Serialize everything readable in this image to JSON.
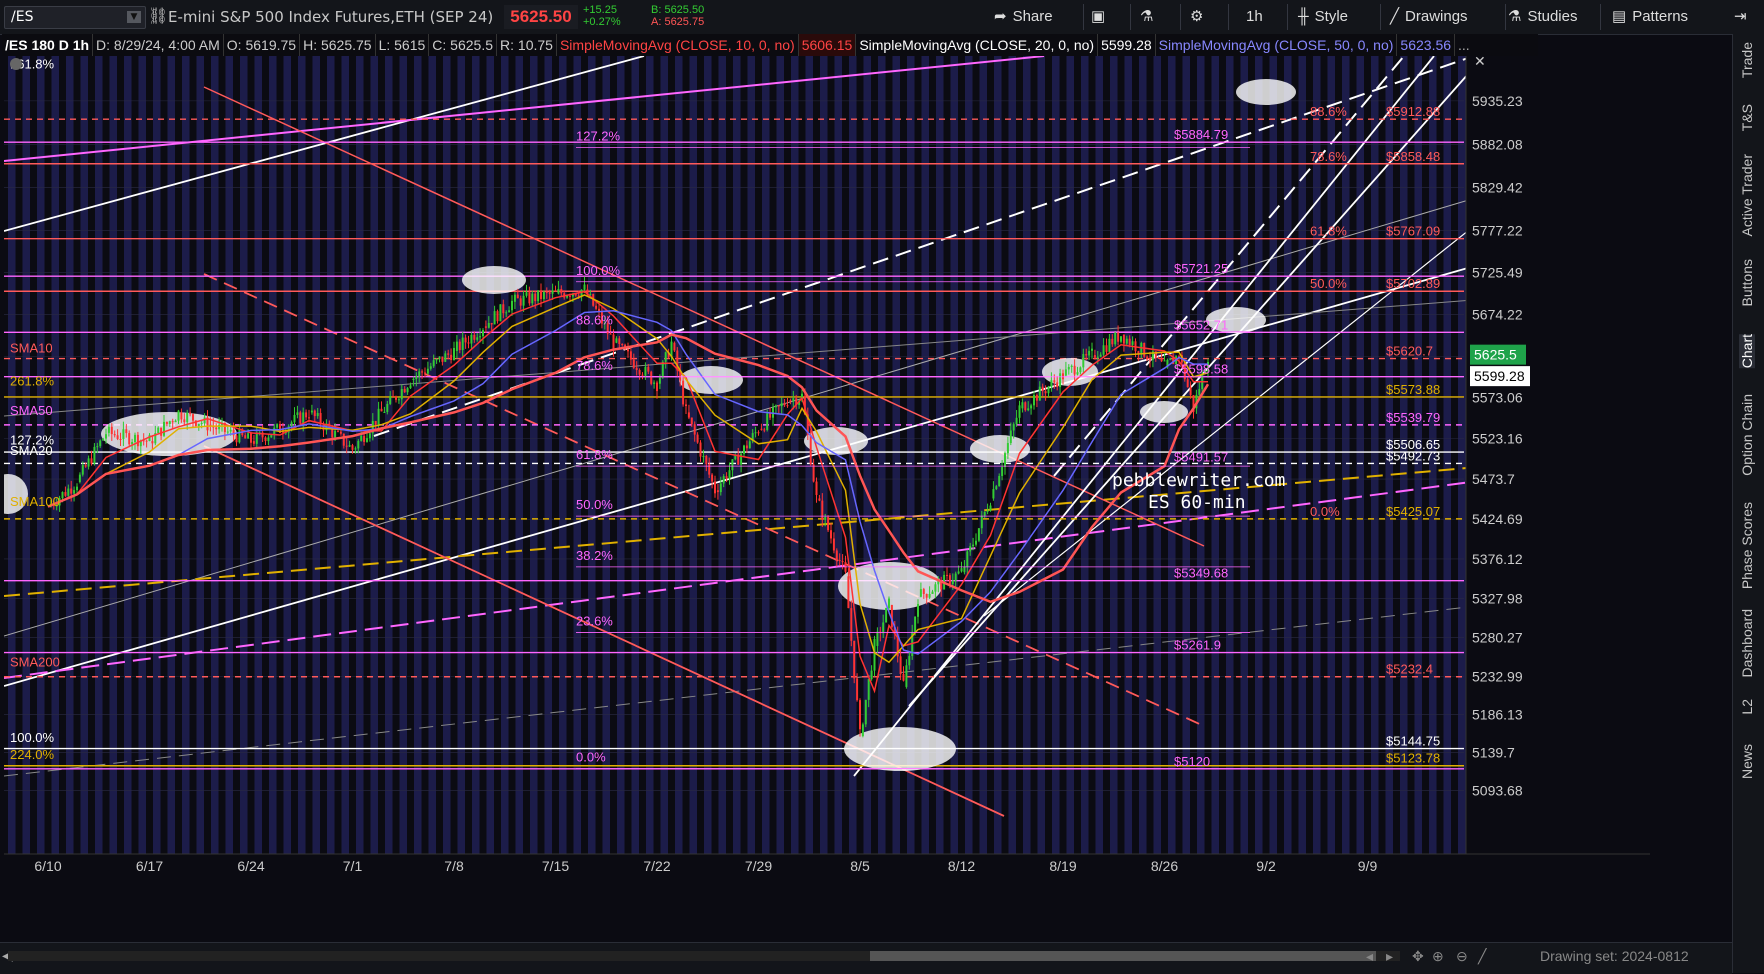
{
  "toolbar": {
    "symbol": "/ES",
    "description": "E-mini S&P 500 Index Futures,ETH (SEP 24)",
    "last_price": "5625.50",
    "net_change": "+15.25",
    "pct_change": "+0.27%",
    "bid": "B: 5625.50",
    "ask": "A: 5625.75",
    "share_label": "Share",
    "timeframe_label": "1h",
    "style_label": "Style",
    "drawings_label": "Drawings",
    "studies_label": "Studies",
    "patterns_label": "Patterns"
  },
  "infobar": {
    "chart_id": "/ES 180 D 1h",
    "date": "D: 8/29/24, 4:00 AM",
    "open": "O: 5619.75",
    "high": "H: 5625.75",
    "low": "L: 5615",
    "close": "C: 5625.5",
    "range": "R: 10.75",
    "sma10_label": "SimpleMovingAvg (CLOSE, 10, 0, no)",
    "sma10_value": "5606.15",
    "sma20_label": "SimpleMovingAvg (CLOSE, 20, 0, no)",
    "sma20_value": "5599.28",
    "sma50_label": "SimpleMovingAvg (CLOSE, 50, 0, no)",
    "sma50_value": "5623.56"
  },
  "right_tabs": [
    "Trade",
    "T&S",
    "Active Trader",
    "Buttons",
    "Chart",
    "Option Chain",
    "Phase Scores",
    "Dashboard",
    "L2",
    "News"
  ],
  "bottombar": {
    "drawing_set": "Drawing set: 2024-0812"
  },
  "colors": {
    "background": "#0b0b12",
    "stripe": "#1c1c4a",
    "grid": "#2a2a44",
    "white_line": "#ffffff",
    "pink": "#ff66ff",
    "red": "#ff5a5a",
    "gold": "#e0b000",
    "gray": "#8a8a8a",
    "sma10": "#ff3333",
    "sma20": "#e0b000",
    "sma50": "#6666ff",
    "sma200": "#ff5555",
    "up": "#33cc33",
    "down": "#ff3333"
  },
  "chart_data": {
    "type": "candlestick",
    "title": "/ES 180 D 1h",
    "watermark": [
      "pebblewriter.com",
      "ES 60-min"
    ],
    "x_ticks": [
      "6/10",
      "6/17",
      "6/24",
      "7/1",
      "7/8",
      "7/15",
      "7/22",
      "7/29",
      "8/5",
      "8/12",
      "8/19",
      "8/26",
      "9/2",
      "9/9"
    ],
    "y_ticks": [
      5935.23,
      5882.08,
      5829.42,
      5777.22,
      5725.49,
      5674.22,
      5623.56,
      5573.06,
      5523.16,
      5473.7,
      5424.69,
      5376.12,
      5327.98,
      5280.27,
      5232.99,
      5186.13,
      5139.7,
      5093.68
    ],
    "y_range": [
      5060,
      5990
    ],
    "last_price_marker": "5625.5",
    "sma20_marker": "5599.28",
    "price_path": [
      [
        "6/10",
        5440
      ],
      [
        "6/12",
        5470
      ],
      [
        "6/14",
        5530
      ],
      [
        "6/17",
        5520
      ],
      [
        "6/19",
        5555
      ],
      [
        "6/21",
        5540
      ],
      [
        "6/24",
        5520
      ],
      [
        "6/26",
        5535
      ],
      [
        "6/28",
        5555
      ],
      [
        "7/1",
        5510
      ],
      [
        "7/3",
        5555
      ],
      [
        "7/5",
        5595
      ],
      [
        "7/8",
        5630
      ],
      [
        "7/10",
        5660
      ],
      [
        "7/12",
        5690
      ],
      [
        "7/15",
        5700
      ],
      [
        "7/17",
        5705
      ],
      [
        "7/19",
        5640
      ],
      [
        "7/22",
        5590
      ],
      [
        "7/23",
        5640
      ],
      [
        "7/24",
        5555
      ],
      [
        "7/26",
        5460
      ],
      [
        "7/29",
        5535
      ],
      [
        "7/31",
        5570
      ],
      [
        "8/1",
        5575
      ],
      [
        "8/2",
        5450
      ],
      [
        "8/4",
        5355
      ],
      [
        "8/5",
        5160
      ],
      [
        "8/6",
        5270
      ],
      [
        "8/7",
        5320
      ],
      [
        "8/8",
        5220
      ],
      [
        "8/9",
        5330
      ],
      [
        "8/12",
        5360
      ],
      [
        "8/14",
        5450
      ],
      [
        "8/16",
        5560
      ],
      [
        "8/19",
        5600
      ],
      [
        "8/21",
        5625
      ],
      [
        "8/23",
        5650
      ],
      [
        "8/26",
        5610
      ],
      [
        "8/27",
        5625
      ],
      [
        "8/28",
        5560
      ],
      [
        "8/29",
        5625
      ]
    ],
    "right_labels": [
      {
        "value": 5912.88,
        "text": "$5912.88",
        "pct": "88.6%"
      },
      {
        "value": 5884.79,
        "text": "$5884.79",
        "pct": ""
      },
      {
        "value": 5858.48,
        "text": "$5858.48",
        "pct": "78.6%"
      },
      {
        "value": 5767.09,
        "text": "$5767.09",
        "pct": "61.8%"
      },
      {
        "value": 5721.25,
        "text": "$5721.25",
        "pct": ""
      },
      {
        "value": 5702.89,
        "text": "$5702.89",
        "pct": "50.0%"
      },
      {
        "value": 5652.71,
        "text": "$5652.71",
        "pct": ""
      },
      {
        "value": 5620.7,
        "text": "$5620.7",
        "pct": ""
      },
      {
        "value": 5598.58,
        "text": "$5598.58",
        "pct": ""
      },
      {
        "value": 5573.88,
        "text": "$5573.88",
        "pct": ""
      },
      {
        "value": 5539.79,
        "text": "$5539.79",
        "pct": ""
      },
      {
        "value": 5506.65,
        "text": "$5506.65",
        "pct": ""
      },
      {
        "value": 5492.73,
        "text": "$5492.73",
        "pct": ""
      },
      {
        "value": 5491.57,
        "text": "$5491.57",
        "pct": ""
      },
      {
        "value": 5425.07,
        "text": "$5425.07",
        "pct": "0.0%"
      },
      {
        "value": 5349.68,
        "text": "$5349.68",
        "pct": ""
      },
      {
        "value": 5261.9,
        "text": "$5261.9",
        "pct": ""
      },
      {
        "value": 5232.4,
        "text": "$5232.4",
        "pct": ""
      },
      {
        "value": 5144.75,
        "text": "$5144.75",
        "pct": ""
      },
      {
        "value": 5123.78,
        "text": "$5123.78",
        "pct": ""
      },
      {
        "value": 5120,
        "text": "$5120",
        "pct": ""
      }
    ],
    "left_labels": [
      {
        "value": 5975,
        "text": "161.8%"
      },
      {
        "value": 5628,
        "text": "SMA10"
      },
      {
        "value": 5588,
        "text": "261.8%"
      },
      {
        "value": 5552,
        "text": "SMA50"
      },
      {
        "value": 5516,
        "text": "127.2%"
      },
      {
        "value": 5503,
        "text": "SMA20"
      },
      {
        "value": 5441,
        "text": "SMA100"
      },
      {
        "value": 5245,
        "text": "SMA200"
      },
      {
        "value": 5153,
        "text": "100.0%"
      },
      {
        "value": 5132,
        "text": "224.0%"
      }
    ],
    "fib_labels": [
      {
        "value": 5887,
        "text": "127.2%"
      },
      {
        "value": 5723,
        "text": "100.0%"
      },
      {
        "value": 5662,
        "text": "88.6%"
      },
      {
        "value": 5607,
        "text": "78.6%"
      },
      {
        "value": 5498,
        "text": "61.8%"
      },
      {
        "value": 5437,
        "text": "50.0%"
      },
      {
        "value": 5375,
        "text": "38.2%"
      },
      {
        "value": 5295,
        "text": "23.6%"
      },
      {
        "value": 5129,
        "text": "0.0%"
      }
    ],
    "sma_series": [
      {
        "name": "SMA10",
        "color": "#ff3333"
      },
      {
        "name": "SMA20",
        "color": "#e0b000"
      },
      {
        "name": "SMA50",
        "color": "#6666ff"
      },
      {
        "name": "SMA200",
        "color": "#ff5555"
      }
    ]
  }
}
